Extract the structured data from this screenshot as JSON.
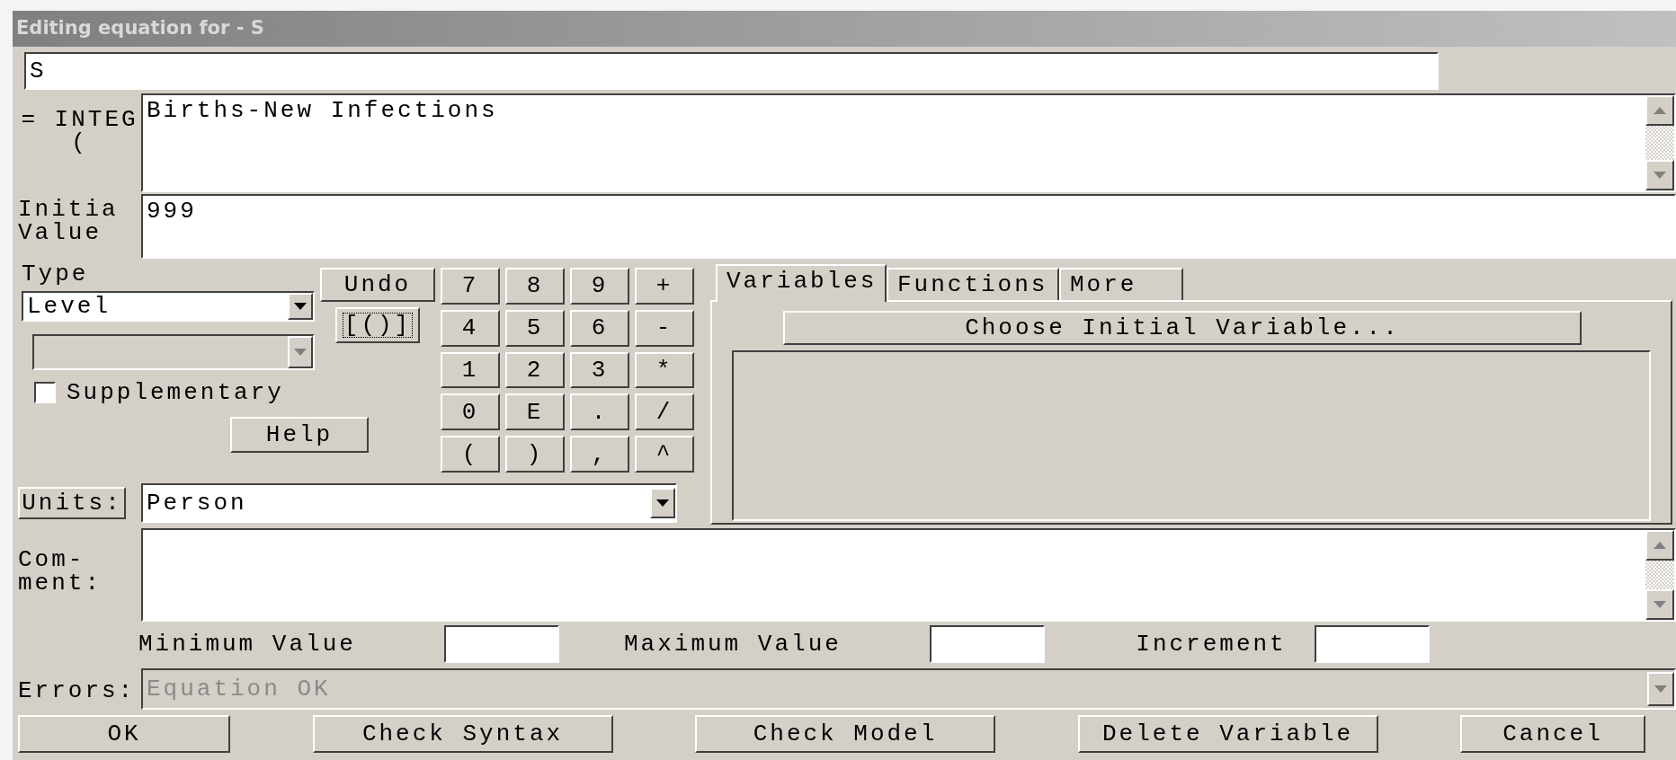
{
  "window": {
    "title": "Editing equation for - S"
  },
  "name_field": {
    "value": "S"
  },
  "equation": {
    "label_lines": [
      "= INTEG",
      "("
    ],
    "value": "Births-New Infections"
  },
  "initial_value": {
    "label_lines": [
      "Initia",
      "Value"
    ],
    "value": "999"
  },
  "type": {
    "label": "Type",
    "value": "Level",
    "subtype_disabled": true
  },
  "supplementary": {
    "label": "Supplementary",
    "checked": false
  },
  "undo_button": "Undo",
  "bracket_button": {
    "label": "[()]",
    "focused": true
  },
  "help_button": "Help",
  "keypad": [
    {
      "label": "7"
    },
    {
      "label": "8"
    },
    {
      "label": "9"
    },
    {
      "label": "+"
    },
    {
      "label": "4"
    },
    {
      "label": "5"
    },
    {
      "label": "6"
    },
    {
      "label": "-"
    },
    {
      "label": "1"
    },
    {
      "label": "2"
    },
    {
      "label": "3"
    },
    {
      "label": "*"
    },
    {
      "label": "0"
    },
    {
      "label": "E"
    },
    {
      "label": "."
    },
    {
      "label": "/"
    },
    {
      "label": "("
    },
    {
      "label": ")"
    },
    {
      "label": ","
    },
    {
      "label": "^"
    }
  ],
  "tabs": [
    {
      "label": "Variables",
      "selected": true
    },
    {
      "label": "Functions",
      "selected": false
    },
    {
      "label": "More",
      "selected": false
    }
  ],
  "choose_button": "Choose Initial Variable...",
  "units": {
    "button": "Units:",
    "value": "Person"
  },
  "comment": {
    "label_lines": [
      "Com-",
      "ment:"
    ]
  },
  "ranges": [
    {
      "label": "Minimum Value"
    },
    {
      "label": "Maximum Value"
    },
    {
      "label": "Increment"
    }
  ],
  "errors": {
    "label": "Errors:",
    "value": "Equation OK",
    "disabled": true
  },
  "buttons": [
    {
      "label": "OK"
    },
    {
      "label": "Check Syntax"
    },
    {
      "label": "Check Model"
    },
    {
      "label": "Delete Variable"
    },
    {
      "label": "Cancel"
    }
  ]
}
